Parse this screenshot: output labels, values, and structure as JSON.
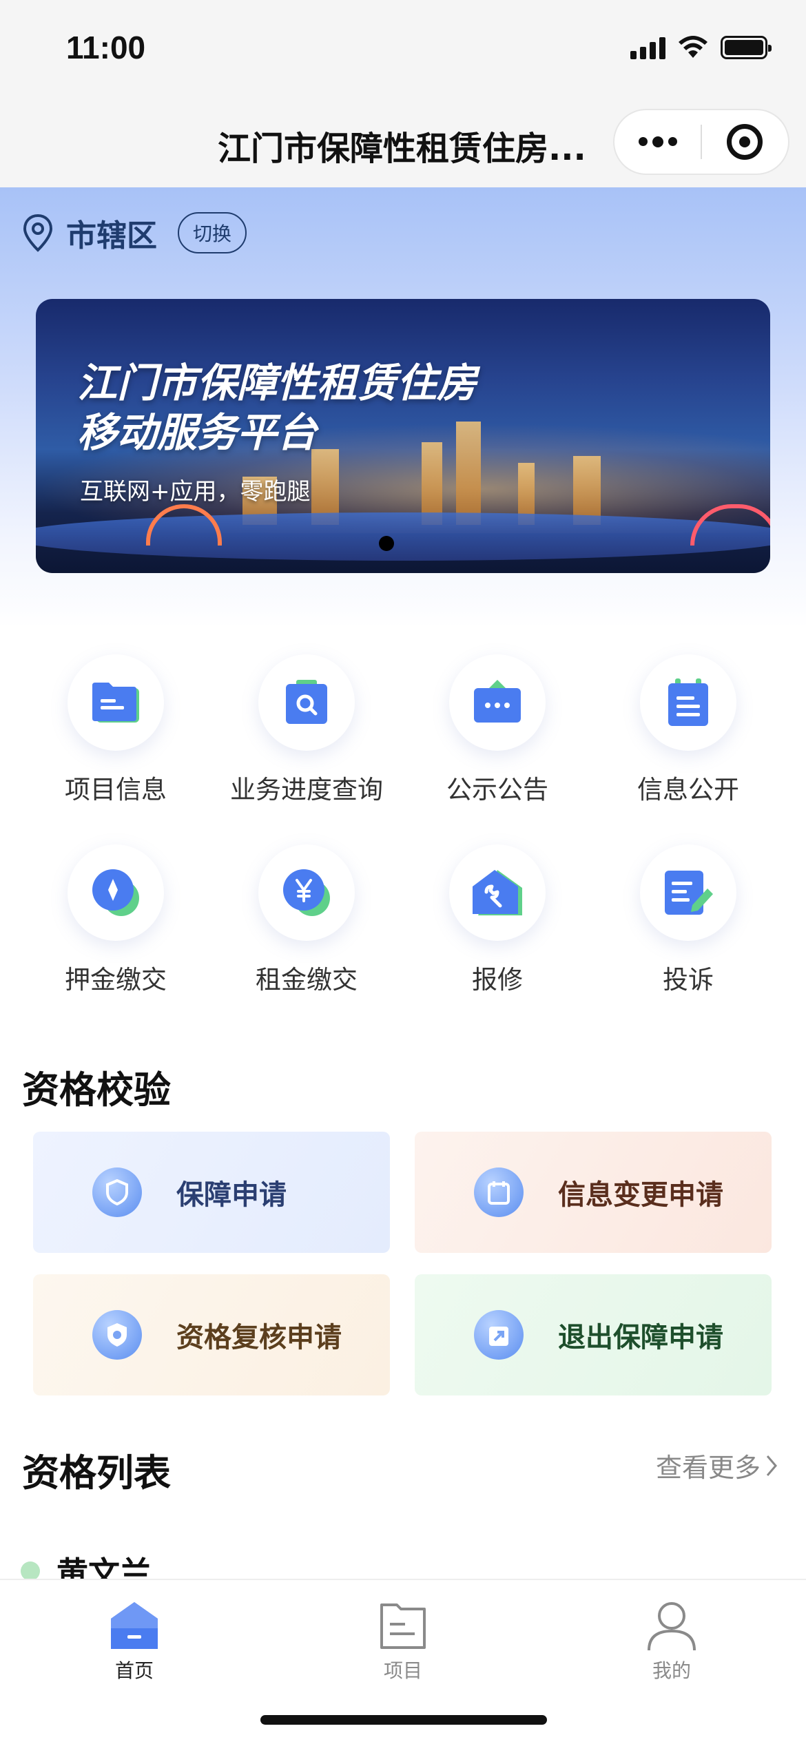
{
  "status_bar": {
    "time": "11:00"
  },
  "nav": {
    "title": "江门市保障性租赁住房..."
  },
  "location": {
    "city": "市辖区",
    "switch_label": "切换"
  },
  "banner": {
    "title_line1": "江门市保障性租赁住房",
    "title_line2": "移动服务平台",
    "subtitle": "互联网+应用，零跑腿"
  },
  "grid": [
    {
      "label": "项目信息",
      "icon": "folder-icon"
    },
    {
      "label": "业务进度查询",
      "icon": "search-doc-icon"
    },
    {
      "label": "公示公告",
      "icon": "announcement-icon"
    },
    {
      "label": "信息公开",
      "icon": "clipboard-icon"
    },
    {
      "label": "押金缴交",
      "icon": "deposit-icon"
    },
    {
      "label": "租金缴交",
      "icon": "yen-icon"
    },
    {
      "label": "报修",
      "icon": "wrench-icon"
    },
    {
      "label": "投诉",
      "icon": "edit-icon"
    }
  ],
  "qualification": {
    "title": "资格校验",
    "cards": [
      {
        "label": "保障申请",
        "icon": "shield-icon"
      },
      {
        "label": "信息变更申请",
        "icon": "calendar-icon"
      },
      {
        "label": "资格复核申请",
        "icon": "shield-check-icon"
      },
      {
        "label": "退出保障申请",
        "icon": "exit-icon"
      }
    ]
  },
  "list": {
    "title": "资格列表",
    "more_label": "查看更多",
    "items": [
      {
        "name": "黄文兰"
      }
    ]
  },
  "tabbar": {
    "items": [
      {
        "label": "首页",
        "icon": "home-icon"
      },
      {
        "label": "项目",
        "icon": "document-icon"
      },
      {
        "label": "我的",
        "icon": "user-icon"
      }
    ]
  },
  "colors": {
    "primary": "#4a7cf0",
    "accent_green": "#5fd08a",
    "hero_top": "#a8c2f7"
  }
}
